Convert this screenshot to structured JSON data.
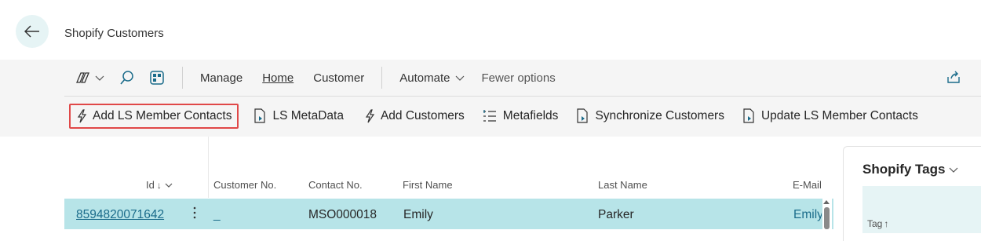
{
  "page": {
    "title": "Shopify Customers"
  },
  "toolbar": {
    "items": [
      "Manage",
      "Home",
      "Customer",
      "Automate",
      "Fewer options"
    ]
  },
  "actions": [
    "Add LS Member Contacts",
    "LS MetaData",
    "Add Customers",
    "Metafields",
    "Synchronize Customers",
    "Update LS Member Contacts"
  ],
  "grid": {
    "columns": [
      "Id",
      "Customer No.",
      "Contact No.",
      "First Name",
      "Last Name",
      "E-Mail"
    ],
    "rows": [
      {
        "id": "8594820071642",
        "customer_no": "_",
        "contact_no": "MSO000018",
        "first_name": "Emily",
        "last_name": "Parker",
        "email": "Emily"
      }
    ]
  },
  "factbox": {
    "title": "Shopify Tags",
    "column": "Tag"
  },
  "colors": {
    "accent": "#1a6b8a",
    "selected_row": "#b7e4e8",
    "highlight_border": "#e04848"
  }
}
